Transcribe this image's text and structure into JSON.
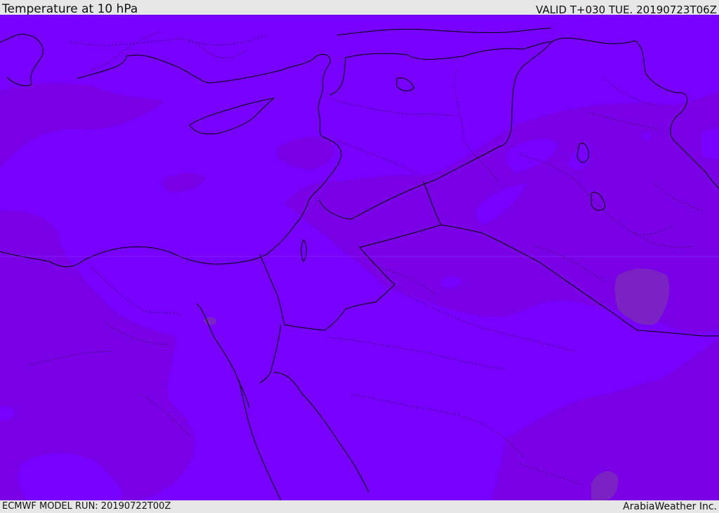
{
  "header": {
    "title": "Temperature at 10 hPa",
    "valid_time": "VALID T+030 TUE. 20190723T06Z"
  },
  "footer": {
    "model_run": "ECMWF MODEL RUN: 20190722T00Z",
    "credit": "ArabiaWeather Inc."
  },
  "colors": {
    "base_fill": "#7700ff",
    "warmer_band": "#7a00e6",
    "warmest_patch": "#7a22c4",
    "coastline": "#000000",
    "border": "#000000",
    "frame": "#e6e6e6"
  },
  "map": {
    "field": "temperature",
    "level": "10 hPa",
    "region": "Eastern Mediterranean and Middle East"
  }
}
